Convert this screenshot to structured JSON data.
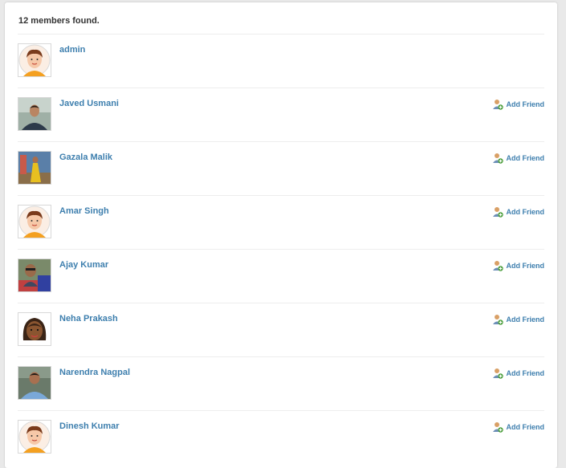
{
  "results": {
    "count_text": "12 members found."
  },
  "members": [
    {
      "name": "admin",
      "avatar": "cartoon-man",
      "add_friend": ""
    },
    {
      "name": "Javed Usmani",
      "avatar": "photo-man-dark-shirt",
      "add_friend": "Add Friend"
    },
    {
      "name": "Gazala Malik",
      "avatar": "photo-woman-yellow",
      "add_friend": "Add Friend"
    },
    {
      "name": "Amar Singh",
      "avatar": "cartoon-man",
      "add_friend": "Add Friend"
    },
    {
      "name": "Ajay Kumar",
      "avatar": "photo-man-sunglasses",
      "add_friend": "Add Friend"
    },
    {
      "name": "Neha Prakash",
      "avatar": "cartoon-woman",
      "add_friend": "Add Friend"
    },
    {
      "name": "Narendra Nagpal",
      "avatar": "photo-man-blue-shirt",
      "add_friend": "Add Friend"
    },
    {
      "name": "Dinesh Kumar",
      "avatar": "cartoon-man",
      "add_friend": "Add Friend"
    }
  ],
  "icons": {
    "add_friend": "add-friend-icon"
  },
  "colors": {
    "link": "#3e7fae",
    "count_text": "#333333",
    "divider": "#ededed"
  }
}
